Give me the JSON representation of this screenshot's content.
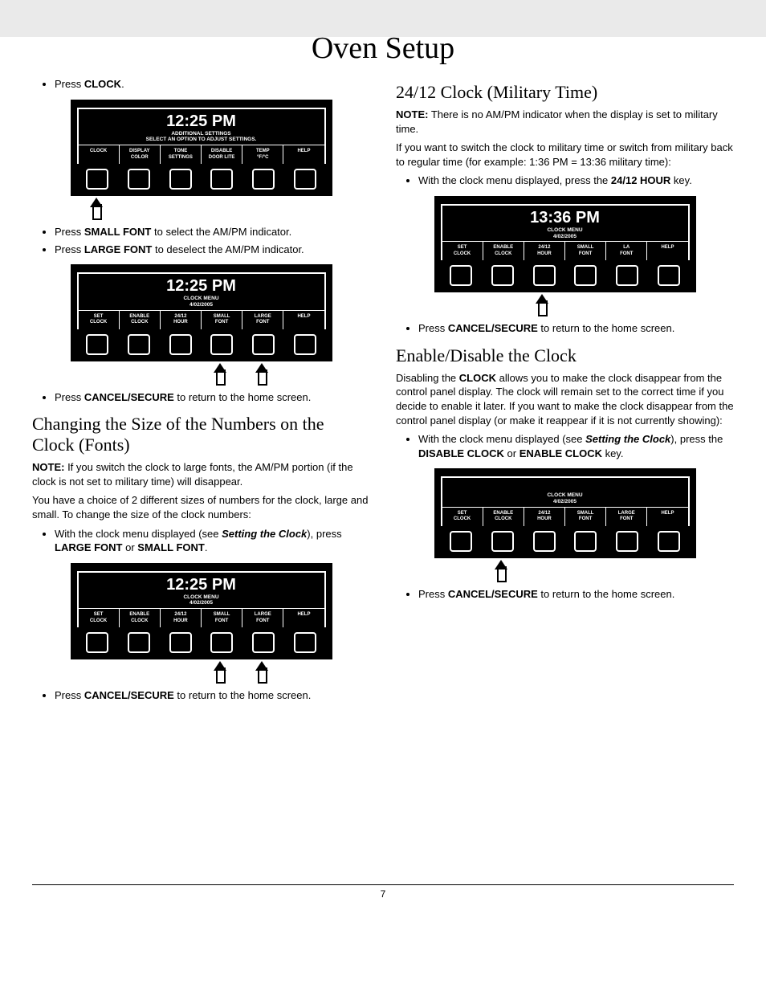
{
  "title": "Oven Setup",
  "page_number": "7",
  "left": {
    "step1": {
      "pre": "Press ",
      "bold": "CLOCK",
      "post": "."
    },
    "panel1": {
      "time": "12:25 PM",
      "sub1": "ADDITIONAL SETTINGS",
      "sub2": "SELECT AN OPTION TO ADJUST SETTINGS.",
      "labels": [
        "CLOCK",
        "DISPLAY\nCOLOR",
        "TONE\nSETTINGS",
        "DISABLE\nDOOR LITE",
        "TEMP\n°F/°C",
        "HELP"
      ]
    },
    "step2": {
      "pre": "Press ",
      "bold": "SMALL FONT",
      "post": " to select the AM/PM indicator."
    },
    "step3": {
      "pre": "Press ",
      "bold": "LARGE FONT",
      "post": " to deselect the AM/PM indicator."
    },
    "panel2": {
      "time": "12:25 PM",
      "sub1": "CLOCK MENU",
      "sub2": "4/02/2005",
      "labels": [
        "SET\nCLOCK",
        "ENABLE\nCLOCK",
        "24/12\nHOUR",
        "SMALL\nFONT",
        "LARGE\nFONT",
        "HELP"
      ]
    },
    "step4": {
      "pre": "Press ",
      "bold": "CANCEL/SECURE",
      "post": " to return to the home screen."
    },
    "section1_title": "Changing the Size of the Numbers on the Clock (Fonts)",
    "note1": {
      "bold": "NOTE:",
      "text": " If you switch the clock to large fonts, the AM/PM portion (if the clock is not set to military time) will disappear."
    },
    "para1": "You have a choice of 2 different sizes of numbers for the clock, large and small. To change the size of the clock numbers:",
    "step5": {
      "pre": "With the clock menu displayed (see ",
      "bolditalic": "Setting the Clock",
      "mid": "), press ",
      "bold1": "LARGE FONT",
      "or": " or ",
      "bold2": "SMALL FONT",
      "post": "."
    },
    "panel3": {
      "time": "12:25 PM",
      "sub1": "CLOCK MENU",
      "sub2": "4/02/2005",
      "labels": [
        "SET\nCLOCK",
        "ENABLE\nCLOCK",
        "24/12\nHOUR",
        "SMALL\nFONT",
        "LARGE\nFONT",
        "HELP"
      ]
    },
    "step6": {
      "pre": "Press ",
      "bold": "CANCEL/SECURE",
      "post": " to return to the home screen."
    }
  },
  "right": {
    "section1_title": "24/12 Clock (Military Time)",
    "note1": {
      "bold": "NOTE:",
      "text": " There is no AM/PM indicator when the display is set to military time."
    },
    "para1": "If you want to switch the clock to military time or switch from military back to regular time (for example: 1:36 PM = 13:36 military time):",
    "step1": {
      "pre": "With the clock menu displayed, press the ",
      "bold": "24/12 HOUR",
      "post": " key."
    },
    "panel1": {
      "time": "13:36 PM",
      "sub1": "CLOCK MENU",
      "sub2": "4/02/2005",
      "labels": [
        "SET\nCLOCK",
        "ENABLE\nCLOCK",
        "24/12\nHOUR",
        "SMALL\nFONT",
        "LA\nFONT",
        "HELP"
      ]
    },
    "step2": {
      "pre": "Press ",
      "bold": "CANCEL/SECURE",
      "post": " to return to the home screen."
    },
    "section2_title": "Enable/Disable the Clock",
    "para2": {
      "pre": "Disabling the ",
      "bold": "CLOCK",
      "post": " allows you to make the clock disappear from the control panel display. The clock will remain set to the correct time if you decide to enable it later. If you want to make the clock disappear from the control panel display (or make it reappear if it is not currently showing):"
    },
    "step3": {
      "pre": "With the clock menu displayed (see ",
      "bolditalic": "Setting the Clock",
      "mid": "), press the ",
      "bold1": "DISABLE CLOCK",
      "or": " or ",
      "bold2": "ENABLE CLOCK",
      "post": " key."
    },
    "panel2": {
      "time": "",
      "sub1": "CLOCK MENU",
      "sub2": "4/02/2005",
      "labels": [
        "SET\nCLOCK",
        "ENABLE\nCLOCK",
        "24/12\nHOUR",
        "SMALL\nFONT",
        "LARGE\nFONT",
        "HELP"
      ]
    },
    "step4": {
      "pre": "Press ",
      "bold": "CANCEL/SECURE",
      "post": " to return to the home screen."
    }
  }
}
